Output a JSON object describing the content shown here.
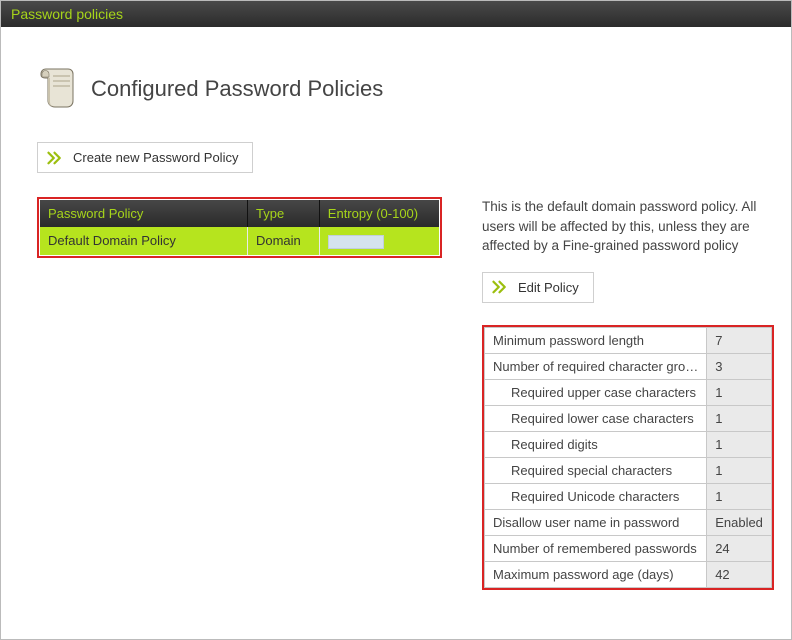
{
  "titlebar": "Password policies",
  "header": {
    "title": "Configured Password Policies"
  },
  "buttons": {
    "create": "Create new Password Policy",
    "edit": "Edit Policy"
  },
  "policy_table": {
    "headers": [
      "Password Policy",
      "Type",
      "Entropy (0-100)"
    ],
    "rows": [
      {
        "name": "Default Domain Policy",
        "type": "Domain",
        "entropy": ""
      }
    ]
  },
  "description": "This is the default domain password policy. All users will be affected by this, unless they are affected by a Fine-grained password policy",
  "details": [
    {
      "label": "Minimum password length",
      "value": "7",
      "indent": false
    },
    {
      "label": "Number of required character gro…",
      "value": "3",
      "indent": false
    },
    {
      "label": "Required upper case characters",
      "value": "1",
      "indent": true
    },
    {
      "label": "Required lower case characters",
      "value": "1",
      "indent": true
    },
    {
      "label": "Required digits",
      "value": "1",
      "indent": true
    },
    {
      "label": "Required special characters",
      "value": "1",
      "indent": true
    },
    {
      "label": "Required Unicode characters",
      "value": "1",
      "indent": true
    },
    {
      "label": "Disallow user name in password",
      "value": "Enabled",
      "indent": false
    },
    {
      "label": "Number of remembered passwords",
      "value": "24",
      "indent": false
    },
    {
      "label": "Maximum password age (days)",
      "value": "42",
      "indent": false
    }
  ]
}
